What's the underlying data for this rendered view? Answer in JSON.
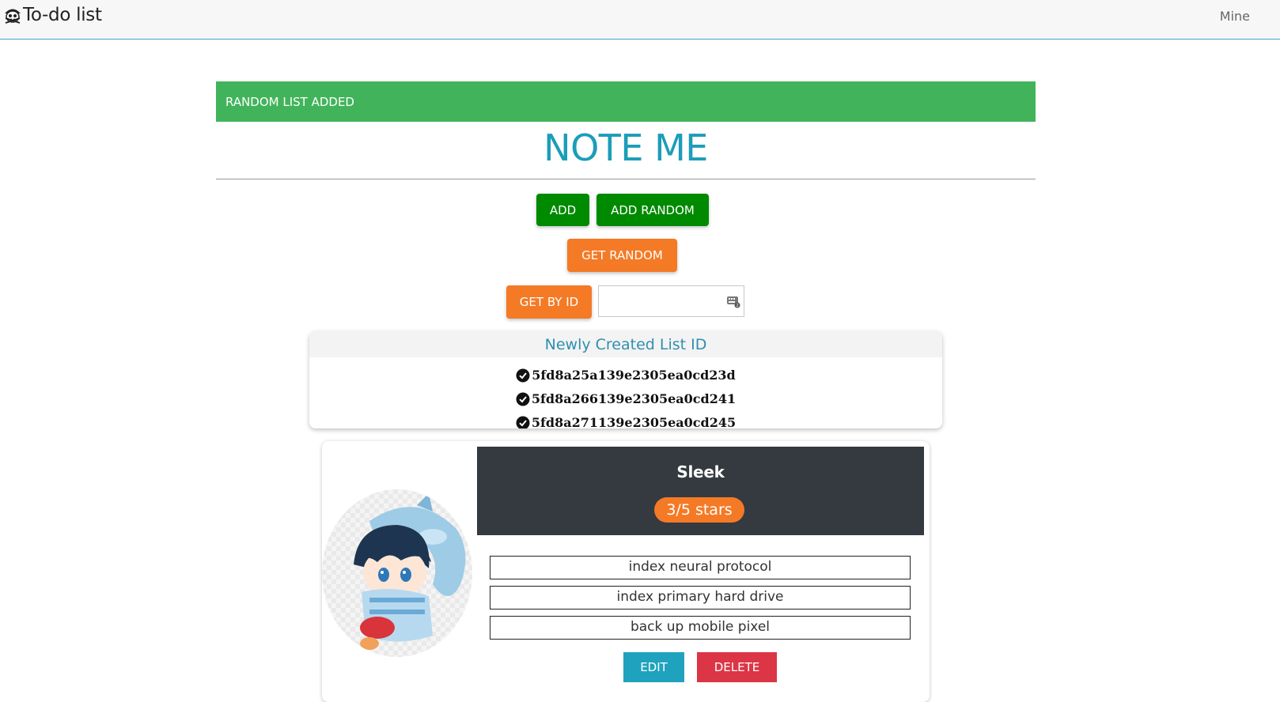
{
  "navbar": {
    "brand": "To-do list",
    "brand_icon": "skull-pirate-icon",
    "right_link": "Mine"
  },
  "alert": {
    "text": "RANDOM LIST ADDED",
    "color": "#41b45b"
  },
  "page_title": "NOTE ME",
  "buttons": {
    "add": "ADD",
    "add_random": "ADD RANDOM",
    "get_random": "GET RANDOM",
    "get_by_id": "GET BY ID"
  },
  "id_input": {
    "value": "",
    "placeholder": ""
  },
  "new_ids": {
    "header": "Newly Created List ID",
    "items": [
      "5fd8a25a139e2305ea0cd23d",
      "5fd8a266139e2305ea0cd241",
      "5fd8a271139e2305ea0cd245"
    ]
  },
  "list": {
    "name": "Sleek",
    "rating": "3/5 stars",
    "rating_value": 3,
    "rating_max": 5,
    "items": [
      "index neural protocol",
      "index primary hard drive",
      "back up mobile pixel"
    ],
    "edit_label": "EDIT",
    "delete_label": "DELETE"
  },
  "colors": {
    "accent": "#1c9db8",
    "green": "#008a00",
    "orange": "#f47a26",
    "danger": "#dc3545",
    "dark": "#343a40"
  }
}
